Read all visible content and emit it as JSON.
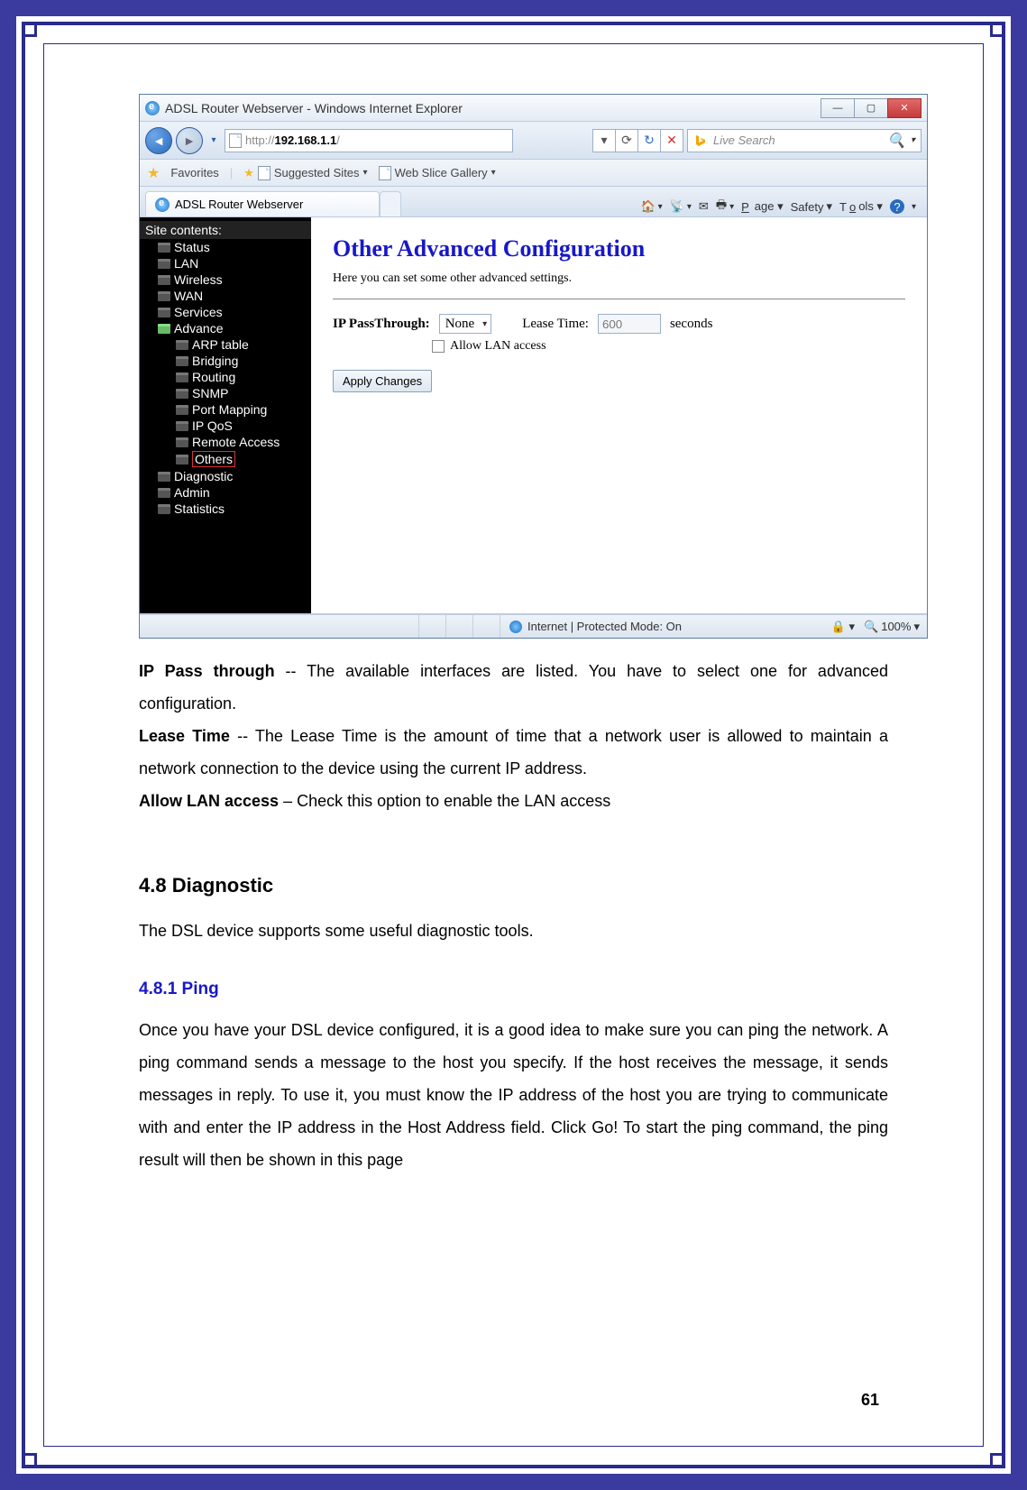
{
  "browser": {
    "title": "ADSL Router Webserver - Windows Internet Explorer",
    "url_prefix": "http://",
    "url_host": "192.168.1.1",
    "url_suffix": "/",
    "search_placeholder": "Live Search",
    "favorites_label": "Favorites",
    "suggested_sites": "Suggested Sites",
    "web_slice": "Web Slice Gallery",
    "tab_title": "ADSL Router Webserver",
    "toolbar": {
      "page": "Page",
      "safety": "Safety",
      "tools": "Tools"
    },
    "status": {
      "zone": "Internet | Protected Mode: On",
      "zoom": "100%"
    }
  },
  "sidebar": {
    "header": "Site contents:",
    "items": [
      {
        "label": "Status",
        "sub": false
      },
      {
        "label": "LAN",
        "sub": false
      },
      {
        "label": "Wireless",
        "sub": false
      },
      {
        "label": "WAN",
        "sub": false
      },
      {
        "label": "Services",
        "sub": false
      },
      {
        "label": "Advance",
        "sub": false,
        "open": true
      },
      {
        "label": "ARP table",
        "sub": true
      },
      {
        "label": "Bridging",
        "sub": true
      },
      {
        "label": "Routing",
        "sub": true
      },
      {
        "label": "SNMP",
        "sub": true
      },
      {
        "label": "Port Mapping",
        "sub": true
      },
      {
        "label": "IP QoS",
        "sub": true
      },
      {
        "label": "Remote Access",
        "sub": true
      },
      {
        "label": "Others",
        "sub": true,
        "hl": true
      },
      {
        "label": "Diagnostic",
        "sub": false
      },
      {
        "label": "Admin",
        "sub": false
      },
      {
        "label": "Statistics",
        "sub": false
      }
    ]
  },
  "panel": {
    "heading": "Other Advanced Configuration",
    "subtext": "Here you can set some other advanced settings.",
    "ip_label": "IP PassThrough:",
    "ip_value": "None",
    "lease_label": "Lease Time:",
    "lease_value": "600",
    "lease_unit": "seconds",
    "allow_lan": "Allow LAN access",
    "apply": "Apply Changes"
  },
  "doc": {
    "p1_term": "IP Pass through",
    "p1_rest": " -- The available interfaces are listed. You have to select one for advanced configuration.",
    "p2_term": "Lease Time",
    "p2_rest": " -- The Lease Time is the amount of time that a network user is allowed to maintain a network connection to the device using the current IP address.",
    "p3_term": "Allow LAN access",
    "p3_rest": " – Check this option to enable the LAN access",
    "h2": "4.8 Diagnostic",
    "h2_text": "The DSL device supports some useful diagnostic tools.",
    "h3": "4.8.1 Ping",
    "h3_text": "Once you have your DSL device configured, it is a good idea to make sure you can ping the network. A ping command sends a message to the host you specify. If the host receives the message, it sends messages in reply. To use it, you must know the IP address of the host you are trying to communicate with and enter the IP address in the Host Address field. Click Go! To start the ping command, the ping result will then be shown in this page",
    "page_number": "61"
  }
}
